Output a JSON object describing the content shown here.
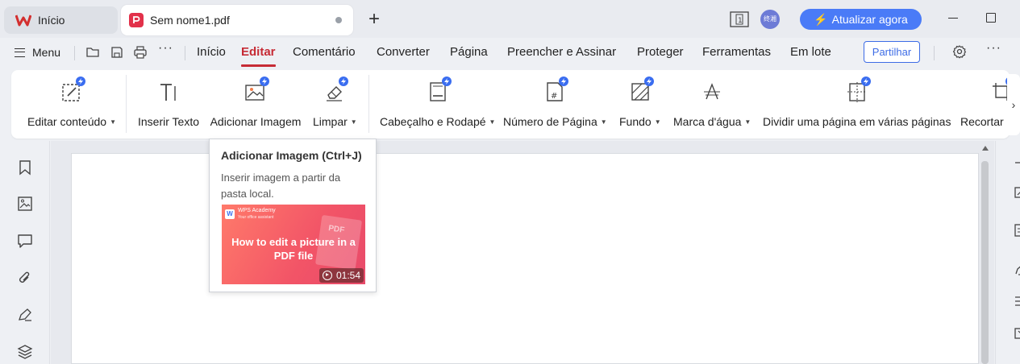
{
  "titlebar": {
    "home_tab_label": "Início",
    "doc_tab_label": "Sem nome1.pdf",
    "new_tab_symbol": "+",
    "avatar_text": "终湘",
    "update_button_label": "Atualizar agora"
  },
  "menubar": {
    "menu_label": "Menu",
    "tabs": [
      "Início",
      "Editar",
      "Comentário",
      "Converter",
      "Página",
      "Preencher e Assinar",
      "Proteger",
      "Ferramentas",
      "Em lote"
    ],
    "active_tab": "Editar",
    "share_label": "Partilhar",
    "more_symbol": "···"
  },
  "ribbon": {
    "buttons": [
      {
        "label": "Editar conteúdo",
        "icon": "edit-content-icon",
        "dropdown": true
      },
      {
        "label": "Inserir Texto",
        "icon": "insert-text-icon",
        "dropdown": false
      },
      {
        "label": "Adicionar Imagem",
        "icon": "add-image-icon",
        "dropdown": false
      },
      {
        "label": "Limpar",
        "icon": "eraser-icon",
        "dropdown": true
      },
      {
        "label": "Cabeçalho e Rodapé",
        "icon": "header-footer-icon",
        "dropdown": true
      },
      {
        "label": "Número de Página",
        "icon": "page-number-icon",
        "dropdown": true
      },
      {
        "label": "Fundo",
        "icon": "background-icon",
        "dropdown": true
      },
      {
        "label": "Marca d'água",
        "icon": "watermark-icon",
        "dropdown": true
      },
      {
        "label": "Dividir uma página em várias páginas",
        "icon": "split-page-icon",
        "dropdown": false
      },
      {
        "label": "Recortar P",
        "icon": "crop-icon",
        "dropdown": false
      }
    ],
    "scroll_right_symbol": "›"
  },
  "tooltip": {
    "title": "Adicionar Imagem (Ctrl+J)",
    "description": "Inserir imagem a partir da pasta local.",
    "video": {
      "brand": "WPS Academy",
      "brand_sub": "Your office assistant",
      "title": "How to edit a picture in a PDF file",
      "decoration_text": "PDF",
      "duration": "01:54"
    }
  },
  "colors": {
    "active_tab": "#c62b35",
    "accent_blue": "#4a7bf7",
    "pdf_red": "#e2314a"
  }
}
